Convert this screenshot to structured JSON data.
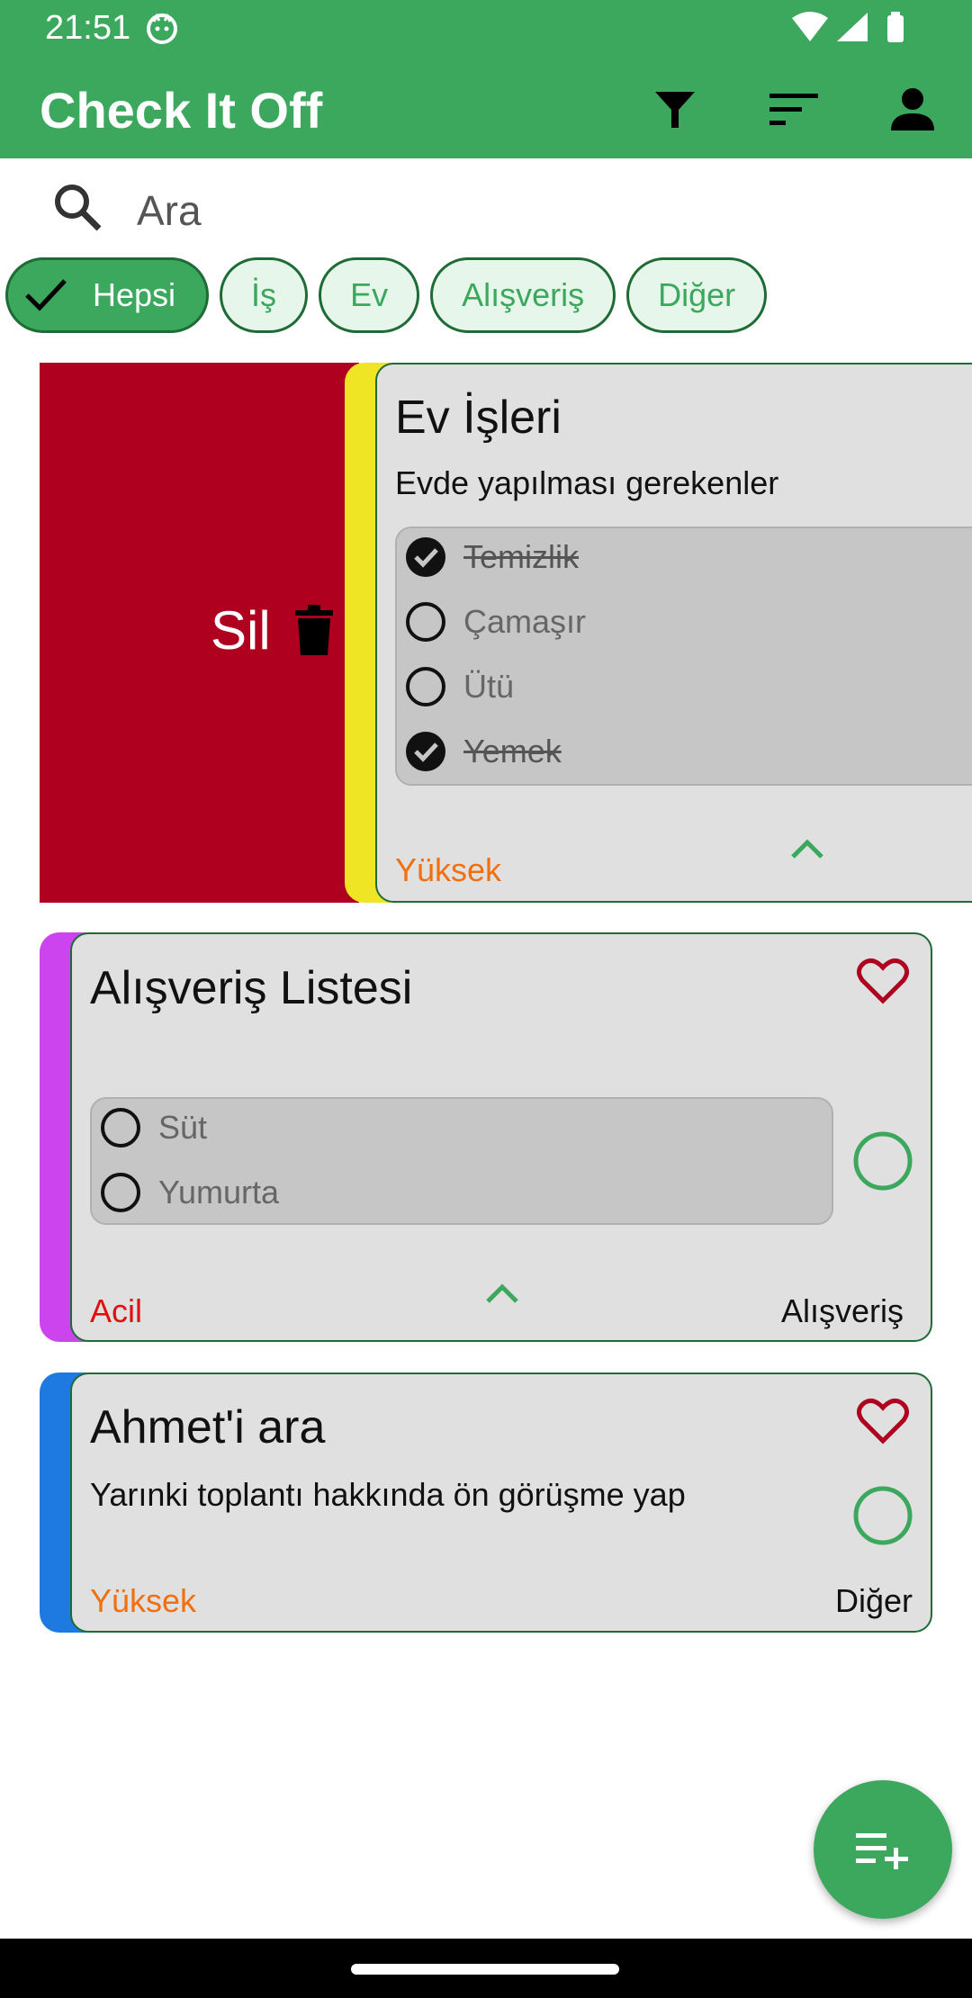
{
  "status_bar": {
    "time": "21:51"
  },
  "app_bar": {
    "title": "Check It Off",
    "actions": [
      "filter-icon",
      "sort-icon",
      "account-icon"
    ]
  },
  "search": {
    "placeholder": "Ara",
    "value": ""
  },
  "chips": [
    {
      "label": "Hepsi",
      "selected": true
    },
    {
      "label": "İş",
      "selected": false
    },
    {
      "label": "Ev",
      "selected": false
    },
    {
      "label": "Alışveriş",
      "selected": false
    },
    {
      "label": "Diğer",
      "selected": false
    }
  ],
  "swipe_action": {
    "label": "Sil",
    "icon": "trash-icon",
    "color": "#b00020"
  },
  "notes": [
    {
      "title": "Ev İşleri",
      "description": "Evde yapılması gerekenler",
      "stripe_color": "#efe524",
      "items": [
        {
          "text": "Temizlik",
          "done": true
        },
        {
          "text": "Çamaşır",
          "done": false
        },
        {
          "text": "Ütü",
          "done": false
        },
        {
          "text": "Yemek",
          "done": true
        }
      ],
      "priority": "Yüksek",
      "expanded": true
    },
    {
      "title": "Alışveriş Listesi",
      "description": "",
      "stripe_color": "#cc44ee",
      "items": [
        {
          "text": "Süt",
          "done": false
        },
        {
          "text": "Yumurta",
          "done": false
        }
      ],
      "priority": "Acil",
      "category": "Alışveriş",
      "favorite_icon": "heart-outline-icon",
      "expanded": true
    },
    {
      "title": "Ahmet'i ara",
      "description": "Yarınki toplantı hakkında ön görüşme yap",
      "stripe_color": "#1e7ae0",
      "items": [],
      "priority": "Yüksek",
      "category": "Diğer",
      "favorite_icon": "heart-outline-icon"
    }
  ],
  "fab": {
    "icon": "playlist-add-icon"
  },
  "colors": {
    "primary": "#3ba85e",
    "card_border": "#1e6b35",
    "card_bg": "#e0e0e0",
    "priority_high": "#f07010",
    "priority_urgent": "#e01010",
    "favorite": "#b00020"
  }
}
